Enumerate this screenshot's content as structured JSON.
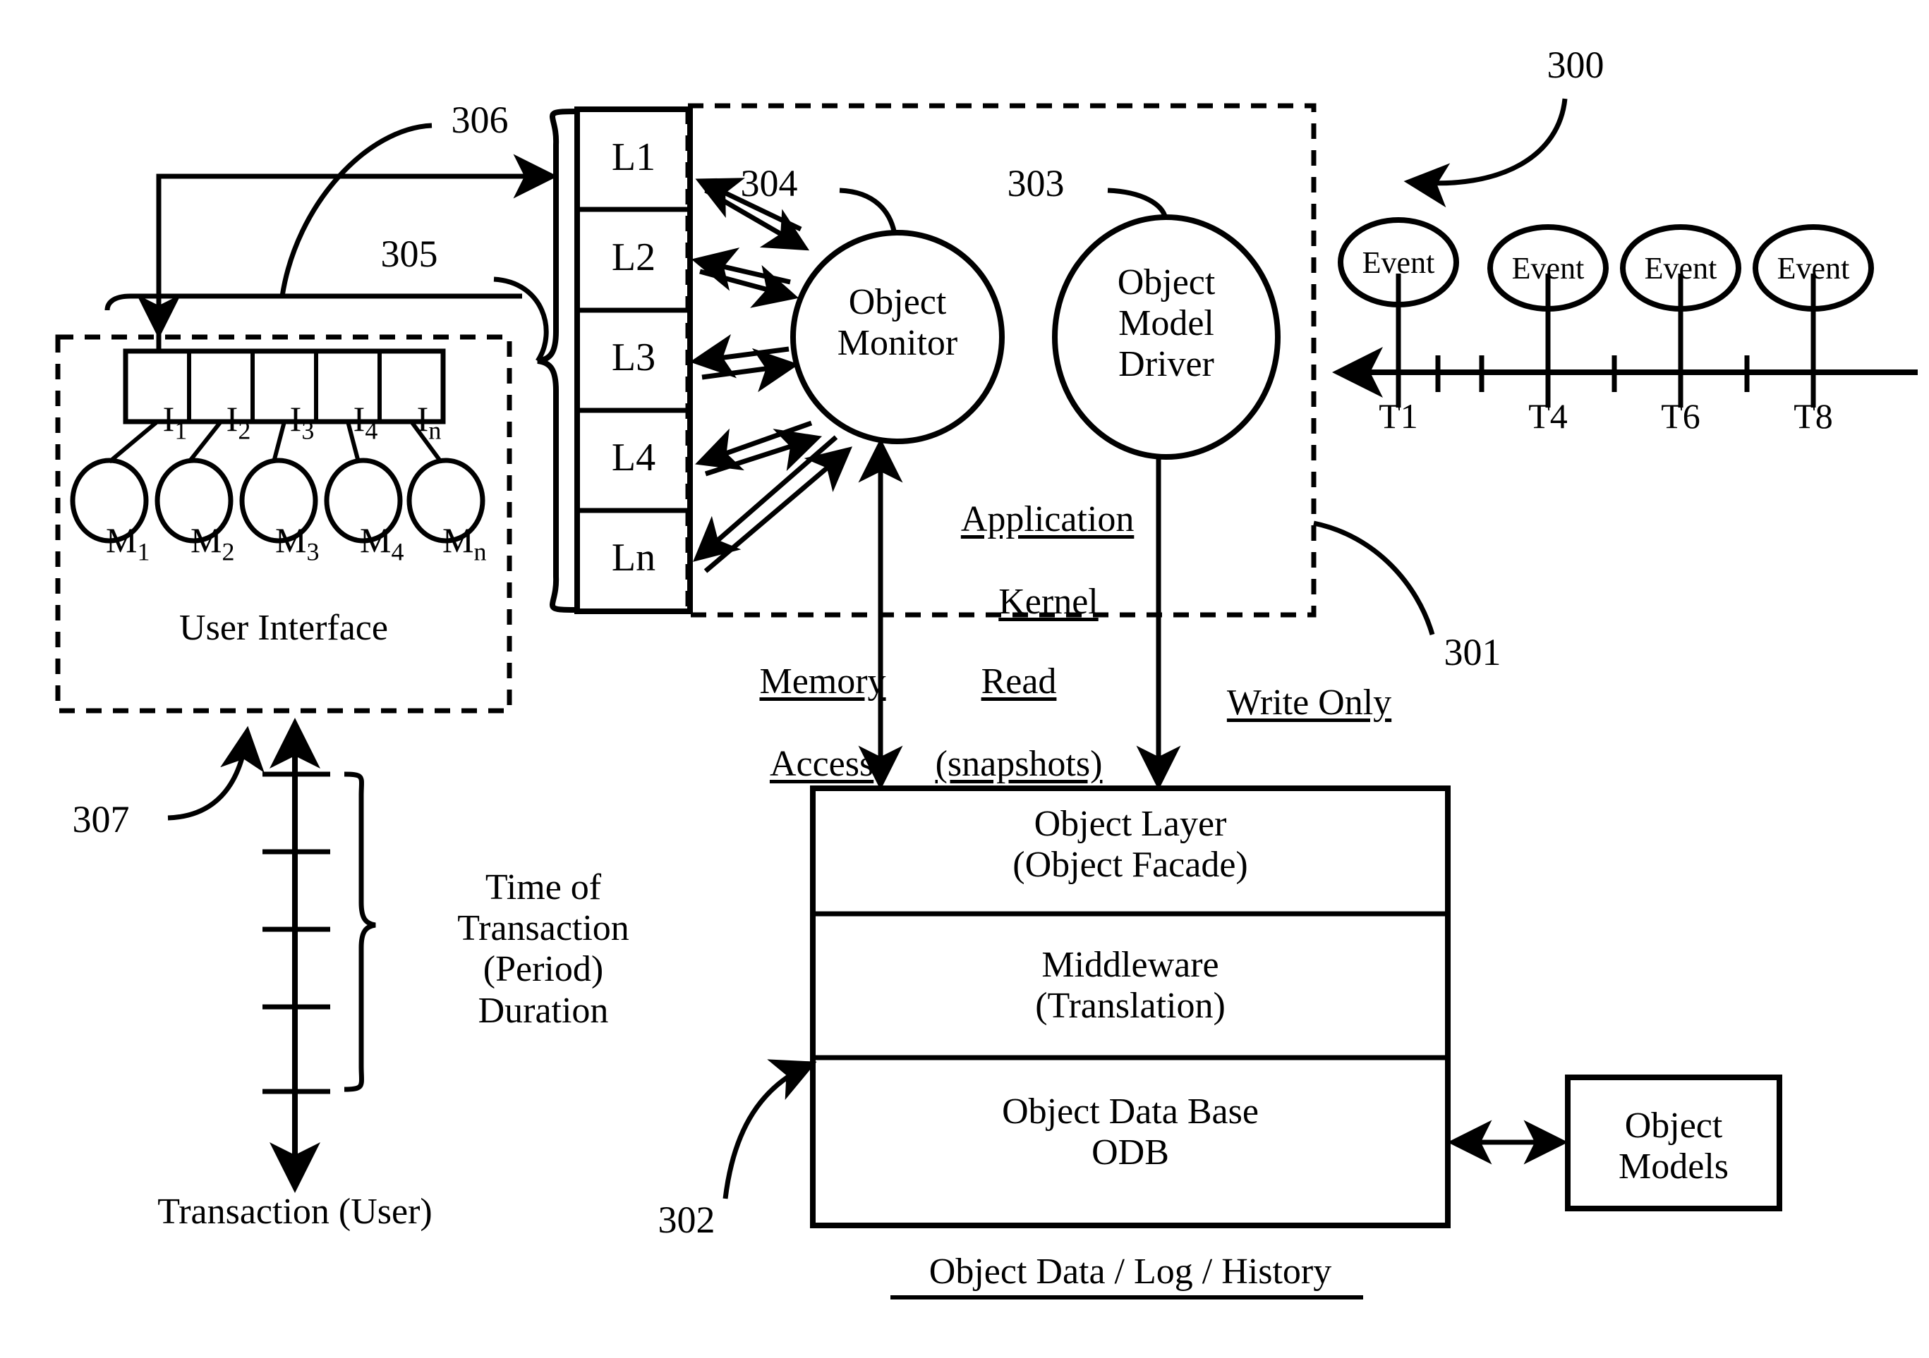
{
  "figure": {
    "title": "Application Kernel / Object Database System Diagram"
  },
  "reference_numerals": {
    "n300": "300",
    "n301": "301",
    "n302": "302",
    "n303": "303",
    "n304": "304",
    "n305": "305",
    "n306": "306",
    "n307": "307"
  },
  "user_interface": {
    "label": "User Interface",
    "interface_cells": [
      {
        "base": "I",
        "sub": "1"
      },
      {
        "base": "I",
        "sub": "2"
      },
      {
        "base": "I",
        "sub": "3"
      },
      {
        "base": "I",
        "sub": "4"
      },
      {
        "base": "I",
        "sub": "n"
      }
    ],
    "module_circles": [
      {
        "base": "M",
        "sub": "1"
      },
      {
        "base": "M",
        "sub": "2"
      },
      {
        "base": "M",
        "sub": "3"
      },
      {
        "base": "M",
        "sub": "4"
      },
      {
        "base": "M",
        "sub": "n"
      }
    ]
  },
  "layer_stack": {
    "cells": [
      "L1",
      "L2",
      "L3",
      "L4",
      "Ln"
    ]
  },
  "application_kernel": {
    "label": "Application\nKernel",
    "object_monitor": "Object\nMonitor",
    "object_model_driver": "Object\nModel\nDriver"
  },
  "connection_labels": {
    "memory_access": "Memory\nAccess",
    "read_snapshots": "Read\n(snapshots)",
    "write_only": "Write Only"
  },
  "object_data_store": {
    "rows": [
      "Object Layer\n(Object Facade)",
      "Middleware\n(Translation)",
      "Object Data Base\nODB"
    ],
    "caption": "Object Data / Log / History"
  },
  "object_models": {
    "label": "Object\nModels"
  },
  "transaction_timeline": {
    "bracket_label": "Time of\nTransaction\n(Period)\nDuration",
    "axis_label": "Transaction (User)",
    "tick_count": 5
  },
  "event_timeline": {
    "events": [
      {
        "label": "Event",
        "tick": "T1"
      },
      {
        "label": "Event",
        "tick": "T4"
      },
      {
        "label": "Event",
        "tick": "T6"
      },
      {
        "label": "Event",
        "tick": "T8"
      }
    ],
    "minor_ticks": 4,
    "direction": "left"
  },
  "colors": {
    "stroke": "#000000",
    "background": "#ffffff"
  }
}
